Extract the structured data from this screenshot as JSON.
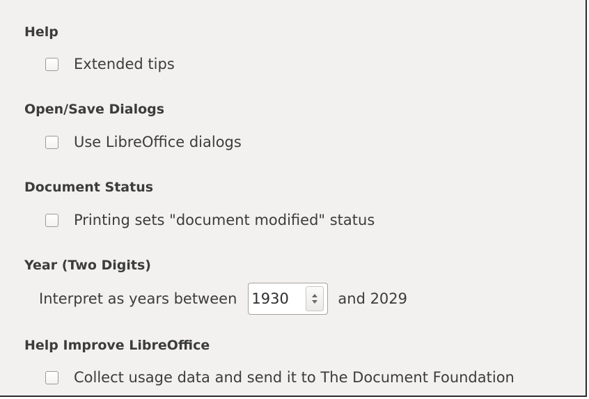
{
  "help": {
    "title": "Help",
    "extended_tips": {
      "label": "Extended tips",
      "checked": false
    }
  },
  "open_save": {
    "title": "Open/Save Dialogs",
    "use_libreoffice_dialogs": {
      "label": "Use LibreOffice dialogs",
      "checked": false
    }
  },
  "document_status": {
    "title": "Document Status",
    "printing_sets_modified": {
      "label": "Printing sets \"document modified\" status",
      "checked": false
    }
  },
  "year": {
    "title": "Year (Two Digits)",
    "interpret_label": "Interpret as years between",
    "start_year": "1930",
    "end_label": "and 2029"
  },
  "improve": {
    "title": "Help Improve LibreOffice",
    "collect_usage": {
      "label": "Collect usage data and send it to The Document Foundation",
      "checked": false
    }
  },
  "colors": {
    "panel_bg": "#f2f1f0",
    "text": "#3c3c3c",
    "frame": "#2b2b2b"
  }
}
